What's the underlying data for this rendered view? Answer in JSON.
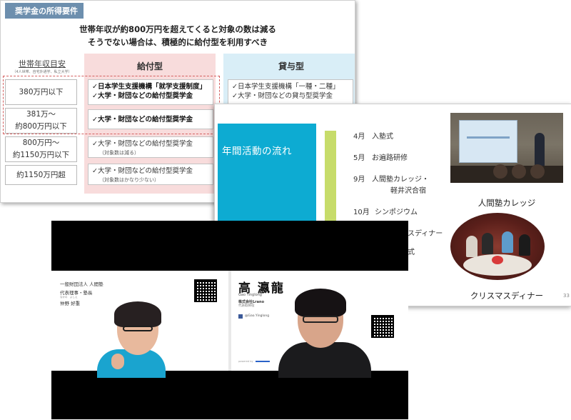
{
  "slide1": {
    "tag": "奨学金の所得要件",
    "headline1": "世帯年収が約800万円を超えてくると対象の数は減る",
    "headline2": "そうでない場合は、積極的に給付型を利用すべき",
    "income_label": "世帯年収目安",
    "income_note": "（4人世帯、自宅外通学、私立大学）",
    "kyufu_header": "給付型",
    "taiyo_header": "貸与型",
    "rows": [
      {
        "income": "380万円以下",
        "kyufu": [
          "✓日本学生支援機構「就学支援制度」",
          "✓大学・財団などの給付型奨学金"
        ],
        "taiyo": [
          "✓日本学生支援機構「一種・二種」",
          "✓大学・財団などの貸与型奨学金"
        ]
      },
      {
        "income": "381万～\n約800万円以下",
        "kyufu": [
          "✓大学・財団などの給付型奨学金"
        ]
      },
      {
        "income": "800万円～\n約1150万円以下",
        "kyufu": [
          "✓大学・財団などの給付型奨学金"
        ],
        "kyufu_note": "（対象数は減る）"
      },
      {
        "income": "約1150万円超",
        "kyufu": [
          "✓大学・財団などの給付型奨学金"
        ],
        "kyufu_note": "（対象数はかなり少ない）"
      }
    ]
  },
  "slide2": {
    "title": "年間活動の流れ",
    "events": [
      {
        "month": "4月",
        "text": "入塾式"
      },
      {
        "month": "5月",
        "text": "お遍路研修"
      },
      {
        "month": "9月",
        "text": "人間塾カレッジ・"
      },
      {
        "month": "",
        "text": "軽井沢合宿"
      },
      {
        "month": "10月",
        "text": "シンポジウム"
      },
      {
        "month": "",
        "text": "スディナー"
      },
      {
        "month": "",
        "text": "式"
      }
    ],
    "photo1_caption": "人間塾カレッジ",
    "photo2_caption": "クリスマスディナー",
    "page_number": "33"
  },
  "video": {
    "left_card": {
      "line1": "一般財団法人 人間塾",
      "line2": "代表理事・塾長",
      "ruby": "なかの　よしえ",
      "name": "仲野 好重"
    },
    "right_card": {
      "name": "高 瀛龍",
      "roman": "Gao Yinglong",
      "company": "株式会社Lrano",
      "company_sub": "代表取締役",
      "facebook": "@Gao.Yinglong",
      "powered": "powered by"
    }
  }
}
